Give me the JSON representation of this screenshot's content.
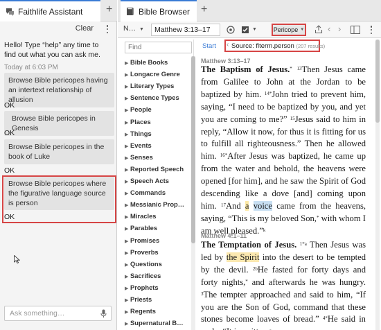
{
  "assistant": {
    "tab_label": "Faithlife Assistant",
    "clear_label": "Clear",
    "greeting": "Hello! Type “help” any time to find out what you can ask me.",
    "timestamp": "Today at 6:03 PM",
    "messages": [
      {
        "user": "Browse Bible pericopes having an intertext relationship of allusion",
        "reply": "OK"
      },
      {
        "user": "Browse Bible pericopes in Genesis",
        "reply": "OK"
      },
      {
        "user": "Browse Bible pericopes in the book of Luke",
        "reply": "OK"
      },
      {
        "user": "Browse Bible pericopes where the figurative language source is person",
        "reply": "OK"
      }
    ],
    "ask_placeholder": "Ask something…"
  },
  "browser": {
    "tab_label": "Bible Browser",
    "nav_label": "N…",
    "reference": "Matthew 3:13–17",
    "pericope_label": "Pericope",
    "find_placeholder": "Find",
    "facets": [
      "Bible Books",
      "Longacre Genre",
      "Literary Types",
      "Sentence Types",
      "People",
      "Places",
      "Things",
      "Events",
      "Senses",
      "Reported Speech",
      "Speech Acts",
      "Commands",
      "Messianic Prop…",
      "Miracles",
      "Parables",
      "Promises",
      "Proverbs",
      "Questions",
      "Sacrifices",
      "Prophets",
      "Priests",
      "Regents",
      "Supernatural B…"
    ],
    "crumb_start": "Start",
    "crumb_sep": "‹",
    "source_label": "Source: flterm.person",
    "source_count": "(207 results)",
    "passage1": {
      "ref": "Matthew 3:13–17",
      "title": "The Baptism of Jesus.",
      "v13": "13",
      "v14": "14",
      "v15": "15",
      "v16": "16",
      "v17": "17"
    },
    "passage2": {
      "ref": "Matthew 4:1–11",
      "title": "The Temptation of Jesus."
    }
  },
  "colors": {
    "highlight_box": "#d64545",
    "accent": "#3a7bd5",
    "highlight_yellow": "#fde9a6",
    "highlight_blue": "#c8dff2"
  }
}
